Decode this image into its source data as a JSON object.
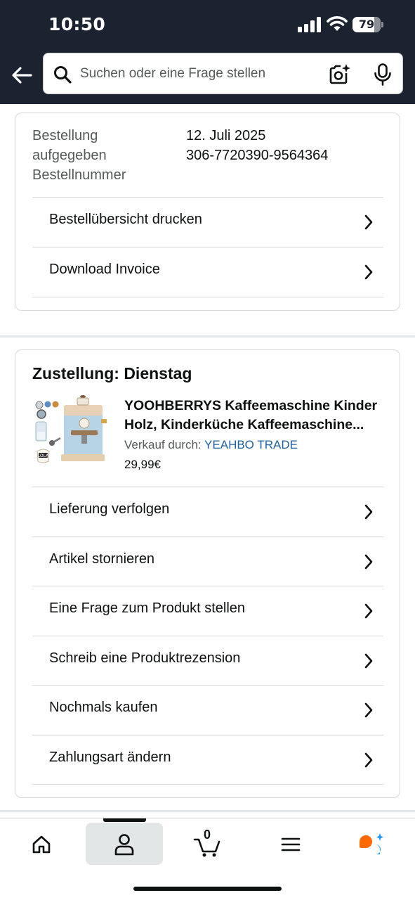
{
  "status_bar": {
    "time": "10:50",
    "battery": "79"
  },
  "search": {
    "placeholder": "Suchen oder eine Frage stellen"
  },
  "order": {
    "labels": [
      "Bestellung",
      "aufgegeben",
      "Bestellnummer"
    ],
    "date": "12. Juli 2025",
    "number": "306-7720390-9564364",
    "actions": [
      {
        "label": "Bestellübersicht drucken"
      },
      {
        "label": "Download Invoice"
      }
    ]
  },
  "delivery": {
    "title": "Zustellung: Dienstag",
    "product": {
      "title_line1": "YOOHBERRYS Kaffeemaschine Kinder",
      "title_line2": "Holz, Kinderküche Kaffeemaschine...",
      "seller_prefix": "Verkauf durch: ",
      "seller_name": "YEAHBO TRADE",
      "price": "29,99€"
    },
    "actions": [
      {
        "label": "Lieferung verfolgen"
      },
      {
        "label": "Artikel stornieren"
      },
      {
        "label": "Eine Frage zum Produkt stellen"
      },
      {
        "label": "Schreib eine Produktrezension"
      },
      {
        "label": "Nochmals kaufen"
      },
      {
        "label": "Zahlungsart ändern"
      }
    ]
  },
  "bottom_nav": {
    "cart_count": "0",
    "items": [
      {
        "icon": "home-icon"
      },
      {
        "icon": "account-icon"
      },
      {
        "icon": "cart-icon"
      },
      {
        "icon": "menu-icon"
      },
      {
        "icon": "rufus-icon"
      }
    ]
  },
  "colors": {
    "header": "#1b2330",
    "link": "#2162a1",
    "rufus_orange": "#ff6a00",
    "rufus_blue": "#1a98ff"
  }
}
